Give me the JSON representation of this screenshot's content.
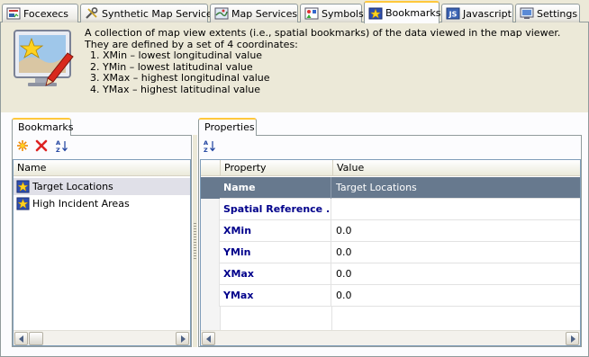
{
  "tabs": [
    {
      "label": "Focexecs",
      "icon": "focexec-icon",
      "active": false
    },
    {
      "label": "Synthetic Map Services",
      "icon": "tools-icon",
      "active": false
    },
    {
      "label": "Map Services",
      "icon": "map-icon",
      "active": false
    },
    {
      "label": "Symbols",
      "icon": "symbols-icon",
      "active": false
    },
    {
      "label": "Bookmarks",
      "icon": "bookmark-icon",
      "active": true
    },
    {
      "label": "Javascript",
      "icon": "javascript-icon",
      "active": false
    },
    {
      "label": "Settings",
      "icon": "settings-icon",
      "active": false
    }
  ],
  "description": {
    "line1": "A collection of map view extents (i.e., spatial bookmarks) of the data viewed in the map viewer.",
    "line2": "They are defined by a set of 4 coordinates:",
    "items": [
      "XMin – lowest longitudinal value",
      "YMin – lowest latitudinal value",
      "XMax – highest longitudinal value",
      "YMax – highest latitudinal value"
    ]
  },
  "bookmarks_panel": {
    "tab_label": "Bookmarks",
    "column_header": "Name",
    "items": [
      {
        "name": "Target Locations",
        "selected": true
      },
      {
        "name": "High Incident Areas",
        "selected": false
      }
    ]
  },
  "properties_panel": {
    "tab_label": "Properties",
    "column_property": "Property",
    "column_value": "Value",
    "rows": [
      {
        "property": "Name",
        "value": "Target Locations",
        "highlight": true
      },
      {
        "property": "Spatial Reference ...",
        "value": ""
      },
      {
        "property": "XMin",
        "value": "0.0"
      },
      {
        "property": "YMin",
        "value": "0.0"
      },
      {
        "property": "XMax",
        "value": "0.0"
      },
      {
        "property": "YMax",
        "value": "0.0"
      }
    ]
  },
  "colors": {
    "active_tab_accent": "#ffc83c",
    "selected_row": "#67798e",
    "property_name": "#00008b"
  }
}
